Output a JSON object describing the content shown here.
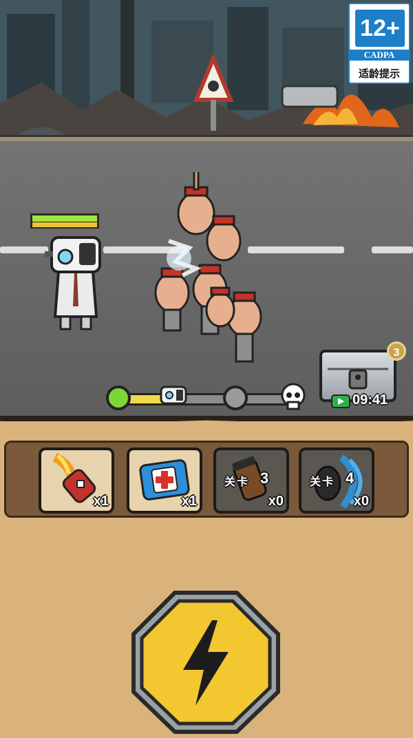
{
  "age_rating": {
    "number": "12+",
    "org": "CADPA",
    "tip": "适龄提示",
    "color": "#1d7fc8"
  },
  "player": {
    "hp_fraction": 1.0
  },
  "wave_progress": {
    "fraction": 0.36,
    "nodes": [
      "start",
      "current",
      "mid",
      "boss"
    ],
    "boss_icon": "skull-icon"
  },
  "chest": {
    "badge": "3",
    "timer": "09:41"
  },
  "items": [
    {
      "name": "rocket",
      "icon": "rocket-icon",
      "count": "x1",
      "locked": false
    },
    {
      "name": "medkit",
      "icon": "medkit-icon",
      "count": "x1",
      "locked": false
    },
    {
      "name": "grenade",
      "icon": "grenade-icon",
      "level_label": "关卡",
      "level_num": "3",
      "count": "x0",
      "locked": true
    },
    {
      "name": "sonic-grenade",
      "icon": "sonic-grenade-icon",
      "level_label": "关卡",
      "level_num": "4",
      "count": "x0",
      "locked": true
    }
  ],
  "action_button": {
    "icon": "lightning-icon",
    "color": "#f2c730"
  }
}
